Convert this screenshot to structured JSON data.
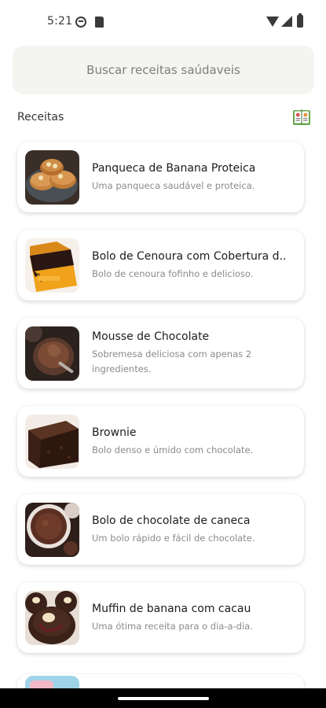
{
  "status_bar": {
    "time": "5:21"
  },
  "search": {
    "placeholder": "Buscar receitas saúdaveis"
  },
  "section": {
    "title": "Receitas"
  },
  "recipes": [
    {
      "title": "Panqueca de Banana Proteica",
      "description": "Uma panqueca saudável e proteica."
    },
    {
      "title": "Bolo de Cenoura com Cobertura d..",
      "description": "Bolo de cenoura fofinho e delicioso."
    },
    {
      "title": "Mousse de Chocolate",
      "description": "Sobremesa deliciosa com apenas 2 ingredientes."
    },
    {
      "title": "Brownie",
      "description": "Bolo denso e úmido com chocolate."
    },
    {
      "title": "Bolo de chocolate de caneca",
      "description": "Um bolo rápido e fácil de chocolate."
    },
    {
      "title": "Muffin de banana com cacau",
      "description": "Uma ótima receita para o dia-a-dia."
    }
  ],
  "icons": {
    "status": [
      "do-not-disturb-icon",
      "sd-card-icon",
      "wifi-icon",
      "cell-signal-icon",
      "battery-icon"
    ],
    "section": "recipe-book-icon"
  }
}
